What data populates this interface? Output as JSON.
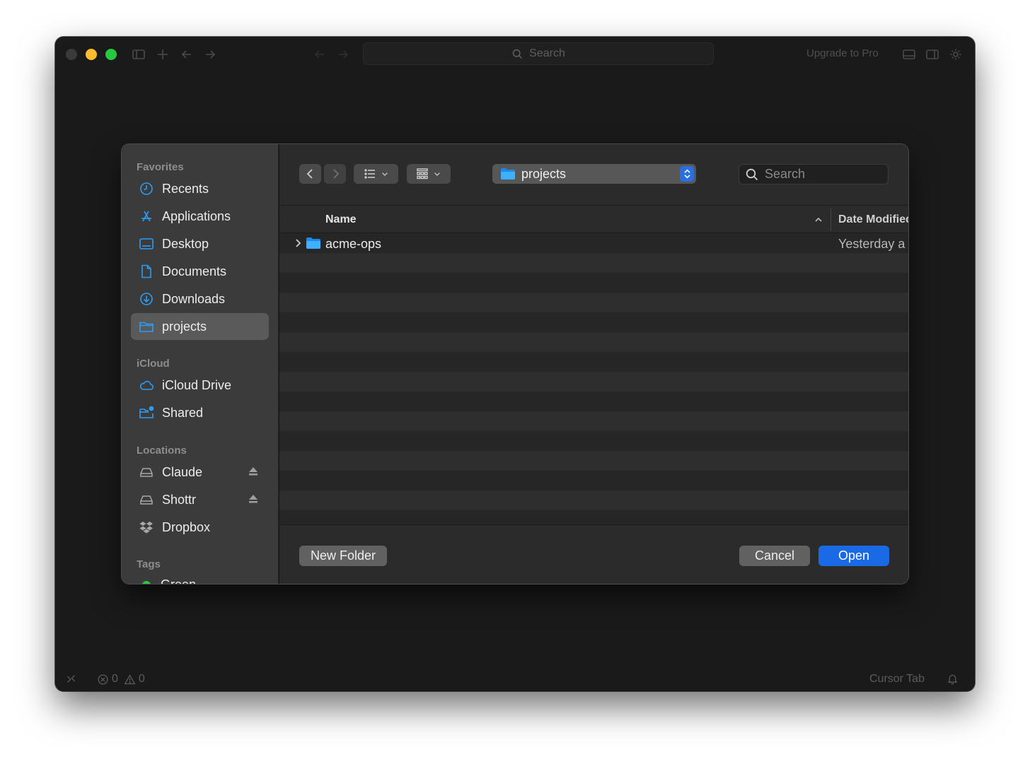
{
  "window": {
    "search_placeholder": "Search",
    "upgrade_label": "Upgrade to Pro"
  },
  "statusbar": {
    "errors": "0",
    "warnings": "0",
    "cursor_tab": "Cursor Tab"
  },
  "dialog": {
    "sidebar": {
      "favorites_header": "Favorites",
      "favorites": [
        {
          "label": "Recents",
          "icon": "clock-icon"
        },
        {
          "label": "Applications",
          "icon": "applications-icon"
        },
        {
          "label": "Desktop",
          "icon": "desktop-icon"
        },
        {
          "label": "Documents",
          "icon": "document-icon"
        },
        {
          "label": "Downloads",
          "icon": "download-icon"
        },
        {
          "label": "projects",
          "icon": "folder-icon",
          "selected": true
        }
      ],
      "icloud_header": "iCloud",
      "icloud": [
        {
          "label": "iCloud Drive",
          "icon": "cloud-icon"
        },
        {
          "label": "Shared",
          "icon": "shared-folder-icon"
        }
      ],
      "locations_header": "Locations",
      "locations": [
        {
          "label": "Claude",
          "icon": "drive-icon",
          "ejectable": true
        },
        {
          "label": "Shottr",
          "icon": "drive-icon",
          "ejectable": true
        },
        {
          "label": "Dropbox",
          "icon": "dropbox-icon"
        }
      ],
      "tags_header": "Tags",
      "tags": [
        {
          "label": "Green",
          "color": "#2ac840"
        }
      ]
    },
    "toolbar": {
      "current_folder": "projects",
      "search_placeholder": "Search"
    },
    "columns": {
      "name": "Name",
      "date_modified": "Date Modified"
    },
    "rows": [
      {
        "name": "acme-ops",
        "date": "Yesterday a",
        "type": "folder"
      }
    ],
    "footer": {
      "new_folder": "New Folder",
      "cancel": "Cancel",
      "open": "Open"
    }
  },
  "colors": {
    "accent": "#1a6ae6",
    "folder_blue": "#2d9cf5"
  }
}
